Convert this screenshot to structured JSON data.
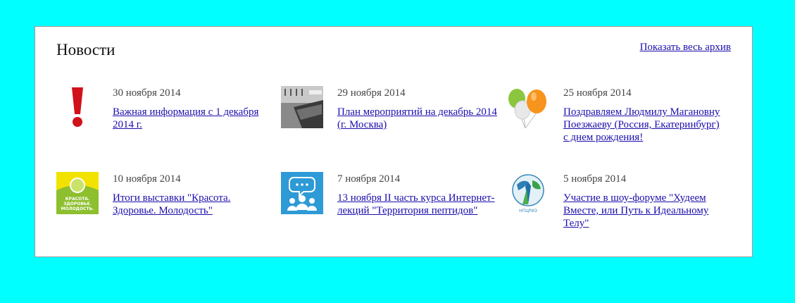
{
  "news": {
    "title": "Новости",
    "archive_link": "Показать весь архив",
    "items": [
      {
        "date": "30 ноября 2014",
        "title": "Важная информация с 1 декабря 2014 г.",
        "icon": "exclamation-icon"
      },
      {
        "date": "29 ноября 2014",
        "title": "План мероприятий на декабрь 2014 (г. Москва)",
        "icon": "planner-photo-icon"
      },
      {
        "date": "25 ноября 2014",
        "title": "Поздравляем Людмилу Магановну Поезжаеву (Россия, Екатеринбург) с днем рождения!",
        "icon": "balloons-icon"
      },
      {
        "date": "10 ноября 2014",
        "title": "Итоги выставки \"Красота. Здоровье. Молодость\"",
        "icon": "exhibition-logo-icon",
        "logo_text": "КРАСОТА. ЗДОРОВЬЕ. МОЛОДОСТЬ."
      },
      {
        "date": "7 ноября 2014",
        "title": "13 ноября II часть курса Интернет-лекций \"Территория пептидов\"",
        "icon": "chat-group-icon"
      },
      {
        "date": "5 ноября 2014",
        "title": "Участие в шоу-форуме \"Худеем Вместе, или Путь к Идеальному Телу\"",
        "icon": "npcriz-logo-icon",
        "logo_text": "НПЦРИЗ"
      }
    ]
  }
}
